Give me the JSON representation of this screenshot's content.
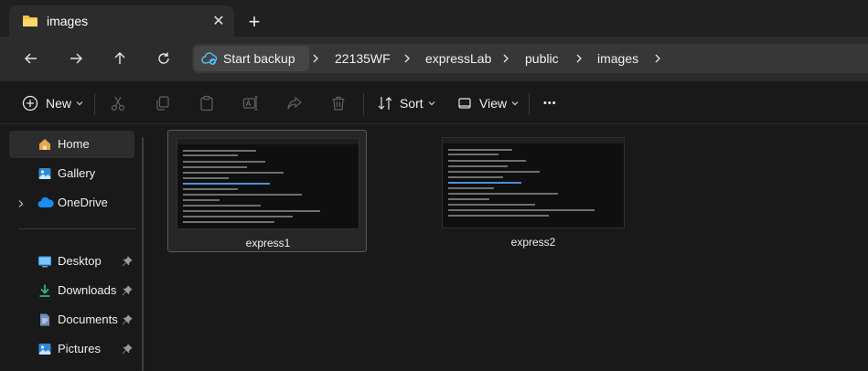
{
  "window": {
    "tab_title": "images",
    "tab_close_glyph": "✕",
    "new_tab_glyph": "+"
  },
  "nav": {
    "back_icon": "arrow-left-icon",
    "forward_icon": "arrow-right-icon",
    "up_icon": "arrow-up-icon",
    "refresh_icon": "refresh-icon"
  },
  "address": {
    "backup_label": "Start backup",
    "crumbs": [
      "22135WF",
      "expressLab",
      "public",
      "images"
    ],
    "separator": "chevron-right-icon"
  },
  "commands": {
    "new_label": "New",
    "sort_label": "Sort",
    "view_label": "View",
    "more_glyph": "•••",
    "icons": [
      "cut-icon",
      "copy-icon",
      "paste-icon",
      "rename-icon",
      "share-icon",
      "delete-icon"
    ]
  },
  "sidebar": {
    "items": [
      {
        "label": "Home",
        "icon": "home-icon"
      },
      {
        "label": "Gallery",
        "icon": "gallery-icon"
      },
      {
        "label": "OneDrive",
        "icon": "cloud-icon"
      },
      {
        "label": "Desktop",
        "icon": "desktop-icon"
      },
      {
        "label": "Downloads",
        "icon": "download-icon"
      },
      {
        "label": "Documents",
        "icon": "documents-icon"
      },
      {
        "label": "Pictures",
        "icon": "pictures-icon"
      }
    ]
  },
  "files": [
    {
      "name": "express1"
    },
    {
      "name": "express2"
    }
  ],
  "colors": {
    "background": "#191919",
    "toolbar": "#2c2c2c",
    "accent_blue": "#4cc2ff",
    "folder_yellow": "#f6c343"
  }
}
